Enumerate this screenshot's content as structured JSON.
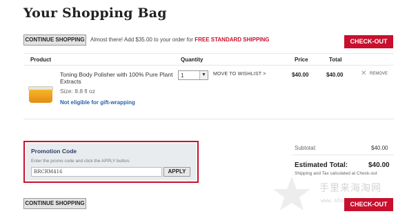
{
  "page": {
    "title": "Your Shopping Bag"
  },
  "top_bar": {
    "continue_label": "CONTINUE SHOPPING",
    "message": "Almost there! Add $35.00 to your order for ",
    "message_highlight": "FREE STANDARD SHIPPING",
    "checkout_label": "CHECK-OUT"
  },
  "table": {
    "headers": {
      "product": "Product",
      "quantity": "Quantity",
      "price": "Price",
      "total": "Total"
    }
  },
  "item": {
    "name": "Toning Body Polisher with 100% Pure Plant Extracts",
    "size": "Size: 8.8 fl oz",
    "gift": "Not eligible for gift-wrapping",
    "qty": "1",
    "move_to_wishlist": "MOVE TO WISHLIST >",
    "price": "$40.00",
    "total": "$40.00",
    "remove": "REMOVE"
  },
  "promo": {
    "title": "Promotion Code",
    "hint": "Enter the promo code and click the APPLY button.",
    "code_value": "BRCRM416",
    "apply_label": "APPLY"
  },
  "summary": {
    "subtotal_label": "Subtotal:",
    "subtotal_value": "$40.00",
    "estimated_label": "Estimated Total:",
    "estimated_value": "$40.00",
    "tax_note": "Shipping and Tax calculated at Check-out"
  },
  "bottom_bar": {
    "continue_label": "CONTINUE SHOPPING",
    "checkout_label": "CHECK-OUT"
  },
  "watermark": {
    "text": "手里来海淘网",
    "url": "www.shoulai.com"
  },
  "colors": {
    "accent_red": "#c8102e",
    "link_blue": "#2a5fa8"
  }
}
